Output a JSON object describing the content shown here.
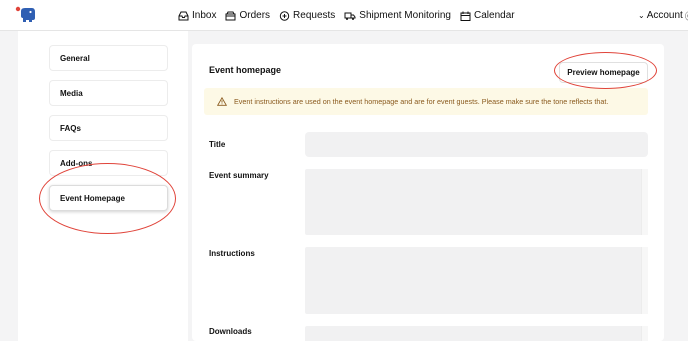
{
  "nav": {
    "items": [
      {
        "label": "Inbox",
        "icon": "inbox-icon"
      },
      {
        "label": "Orders",
        "icon": "orders-icon"
      },
      {
        "label": "Requests",
        "icon": "plus-circle-icon"
      },
      {
        "label": "Shipment Monitoring",
        "icon": "truck-icon"
      },
      {
        "label": "Calendar",
        "icon": "calendar-icon"
      }
    ],
    "account_label": "Account",
    "account_suffix": "Ⓒ"
  },
  "sidebar": {
    "items": [
      {
        "label": "General"
      },
      {
        "label": "Media"
      },
      {
        "label": "FAQs"
      },
      {
        "label": "Add-ons"
      },
      {
        "label": "Event Homepage",
        "active": true
      }
    ]
  },
  "main": {
    "title": "Event homepage",
    "preview_button": "Preview homepage",
    "alert_text": "Event instructions are used on the event homepage and are for event guests. Please make sure the tone reflects that.",
    "fields": [
      {
        "label": "Title",
        "value": ""
      },
      {
        "label": "Event summary",
        "value": ""
      },
      {
        "label": "Instructions",
        "value": ""
      },
      {
        "label": "Downloads",
        "value": ""
      }
    ]
  },
  "colors": {
    "annotation": "#e0443a",
    "alert_bg": "#fdf9e6",
    "alert_text": "#8a5a1e",
    "logo_blue": "#2f5fb3",
    "logo_red": "#e0443a"
  }
}
